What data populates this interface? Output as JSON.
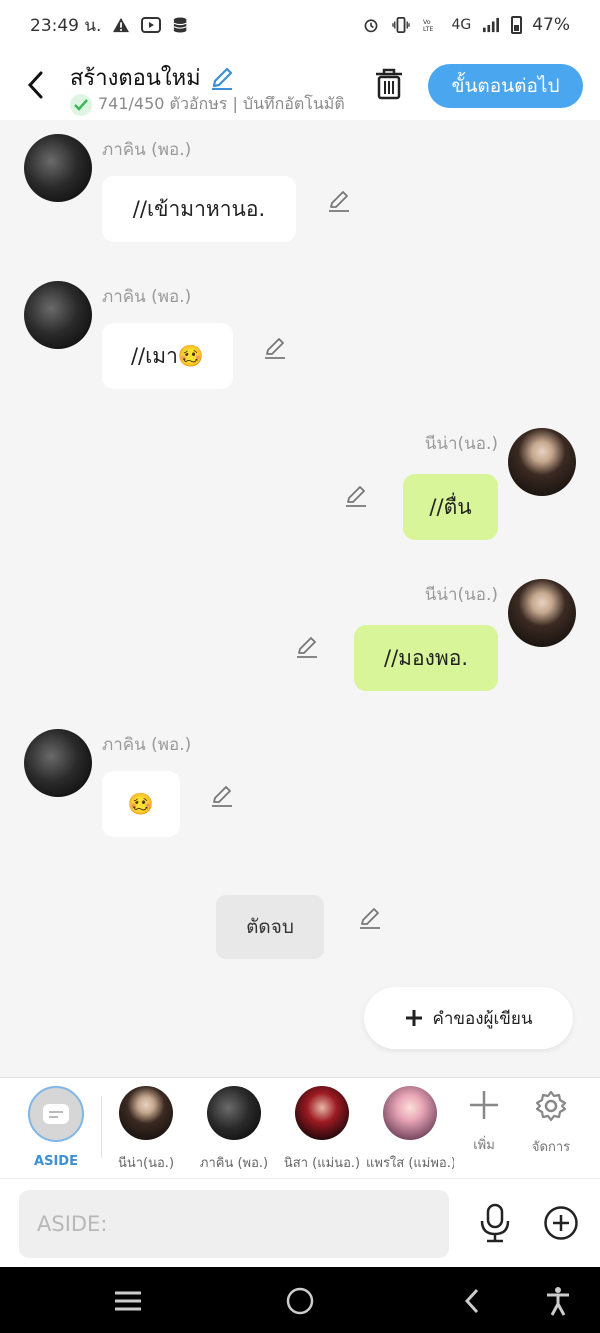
{
  "status_bar": {
    "time": "23:49 น.",
    "network": "4G",
    "battery": "47%"
  },
  "header": {
    "title": "สร้างตอนใหม่",
    "subtitle": "741/450 ตัวอักษร | บันทึกอัตโนมัติ",
    "next_button": "ขั้นตอนต่อไป"
  },
  "messages": [
    {
      "sender": "ภาคิน (พอ.)",
      "text": "//เข้ามาหานอ.",
      "side": "left"
    },
    {
      "sender": "ภาคิน (พอ.)",
      "text": "//เมา🥴",
      "side": "left"
    },
    {
      "sender": "นีน่า(นอ.)",
      "text": "//ตื่น",
      "side": "right"
    },
    {
      "sender": "นีน่า(นอ.)",
      "text": "//มองพอ.",
      "side": "right"
    },
    {
      "sender": "ภาคิน (พอ.)",
      "text": "🥴",
      "side": "left"
    }
  ],
  "cut_button": "ตัดจบ",
  "author_note_button": "คำของผู้เขียน",
  "characters": {
    "aside": "ASIDE",
    "items": [
      {
        "name": "นีน่า(นอ.)",
        "avatar": "woman-long-hair"
      },
      {
        "name": "ภาคิน (พอ.)",
        "avatar": "man-dark"
      },
      {
        "name": "นิสา (แม่นอ.)",
        "avatar": "woman-red"
      },
      {
        "name": "แพรใส (แม่พอ.)",
        "avatar": "woman-pink"
      }
    ],
    "add_label": "เพิ่ม",
    "manage_label": "จัดการ"
  },
  "input": {
    "placeholder": "ASIDE:"
  },
  "colors": {
    "accent": "#4aa6ee",
    "right_bubble": "#d9f59a",
    "left_bubble": "#ffffff",
    "background": "#f5f5f5"
  }
}
